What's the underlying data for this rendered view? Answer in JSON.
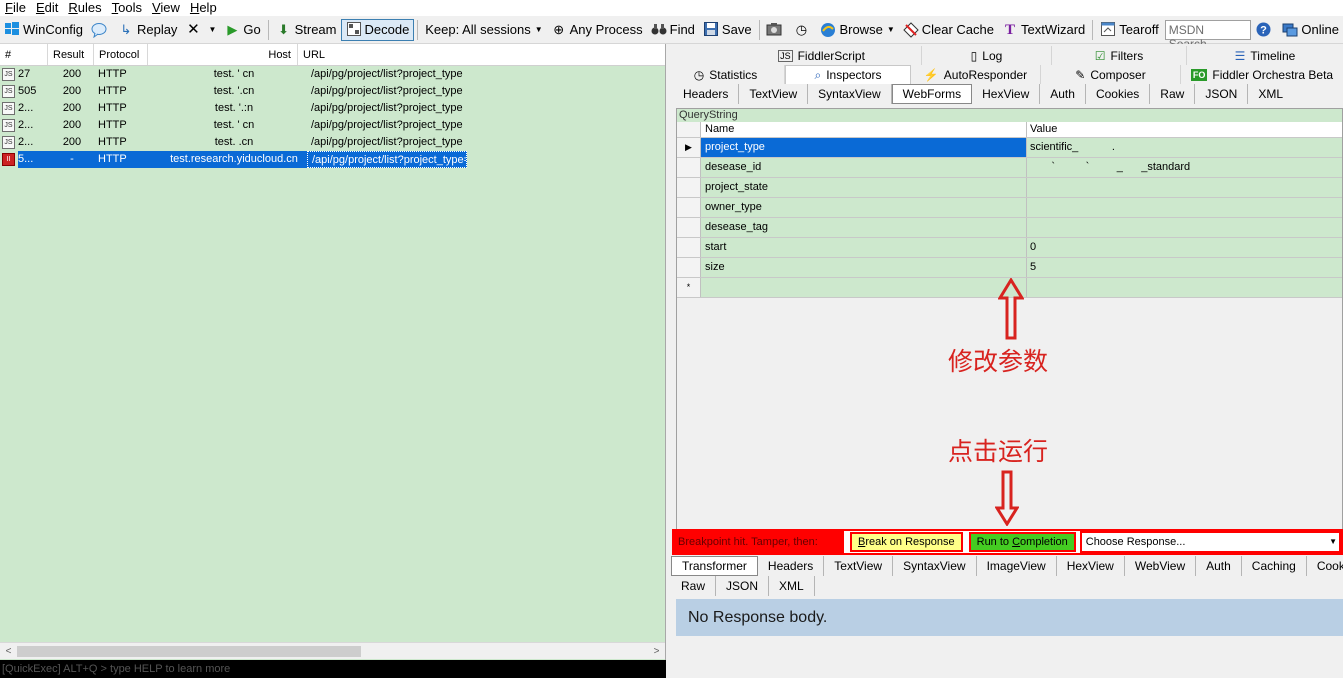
{
  "menu": [
    {
      "key": "F",
      "rest": "ile"
    },
    {
      "key": "E",
      "rest": "dit"
    },
    {
      "key": "R",
      "rest": "ules"
    },
    {
      "key": "T",
      "rest": "ools"
    },
    {
      "key": "V",
      "rest": "iew"
    },
    {
      "key": "H",
      "rest": "elp"
    }
  ],
  "toolbar": {
    "winconfig": "WinConfig",
    "replay": "Replay",
    "go": "Go",
    "stream": "Stream",
    "decode": "Decode",
    "keep": "Keep: All sessions",
    "any_process": "Any Process",
    "find": "Find",
    "save": "Save",
    "browse": "Browse",
    "clear_cache": "Clear Cache",
    "textwizard": "TextWizard",
    "tearoff": "Tearoff",
    "msdn_placeholder": "MSDN Search...",
    "online": "Online"
  },
  "session_list": {
    "columns": [
      "#",
      "Result",
      "Protocol",
      "Host",
      "URL"
    ],
    "rows": [
      {
        "num": "27",
        "result": "200",
        "protocol": "HTTP",
        "host": "test.                 ' cn",
        "url": "/api/pg/project/list?project_type",
        "selected": false
      },
      {
        "num": "505",
        "result": "200",
        "protocol": "HTTP",
        "host": "test.                 '.cn",
        "url": "/api/pg/project/list?project_type",
        "selected": false
      },
      {
        "num": "2...",
        "result": "200",
        "protocol": "HTTP",
        "host": "test.                 '.:n",
        "url": "/api/pg/project/list?project_type",
        "selected": false
      },
      {
        "num": "2...",
        "result": "200",
        "protocol": "HTTP",
        "host": "test.                 ' cn",
        "url": "/api/pg/project/list?project_type",
        "selected": false
      },
      {
        "num": "2...",
        "result": "200",
        "protocol": "HTTP",
        "host": "test.                 .cn",
        "url": "/api/pg/project/list?project_type",
        "selected": false
      },
      {
        "num": "5...",
        "result": "-",
        "protocol": "HTTP",
        "host": "test.research.yiducloud.cn",
        "url": "/api/pg/project/list?project_type=",
        "selected": true
      }
    ]
  },
  "quickexec": "[QuickExec] ALT+Q > type HELP to learn more",
  "top_tabs_row1": [
    "FiddlerScript",
    "Log",
    "Filters",
    "Timeline"
  ],
  "top_tabs_row2": [
    "Statistics",
    "Inspectors",
    "AutoResponder",
    "Composer",
    "Fiddler Orchestra Beta"
  ],
  "fo_badge": "FO",
  "request_tabs": [
    "Headers",
    "TextView",
    "SyntaxView",
    "WebForms",
    "HexView",
    "Auth",
    "Cookies",
    "Raw",
    "JSON",
    "XML"
  ],
  "querystring": {
    "title": "QueryString",
    "header_name": "Name",
    "header_value": "Value",
    "rows": [
      {
        "name": "project_type",
        "value": "scientific_           .",
        "selected": true
      },
      {
        "name": "desease_id",
        "value": "       `          `         _      _standard",
        "selected": false
      },
      {
        "name": "project_state",
        "value": "",
        "selected": false
      },
      {
        "name": "owner_type",
        "value": "",
        "selected": false
      },
      {
        "name": "desease_tag",
        "value": "",
        "selected": false
      },
      {
        "name": "start",
        "value": "0",
        "selected": false
      },
      {
        "name": "size",
        "value": "5",
        "selected": false
      }
    ],
    "new_row_marker": "*"
  },
  "annotations": {
    "modify_params": "修改参数",
    "click_run": "点击运行"
  },
  "breakpoint": {
    "label": "Breakpoint hit. Tamper, then:",
    "break_key": "B",
    "break_rest": "reak on Response",
    "run_pre": "Run to ",
    "run_key": "C",
    "run_rest": "ompletion",
    "choose": "Choose Response..."
  },
  "response_tabs_row1": [
    "Transformer",
    "Headers",
    "TextView",
    "SyntaxView",
    "ImageView",
    "HexView",
    "WebView",
    "Auth",
    "Caching",
    "Cookies"
  ],
  "response_tabs_row2": [
    "Raw",
    "JSON",
    "XML"
  ],
  "response_body": "No Response body.",
  "colors": {
    "session_bg": "#cde8cd",
    "selection": "#0a6ad6",
    "annotation_red": "#d8231f",
    "response_bg": "#b9cfe4"
  }
}
